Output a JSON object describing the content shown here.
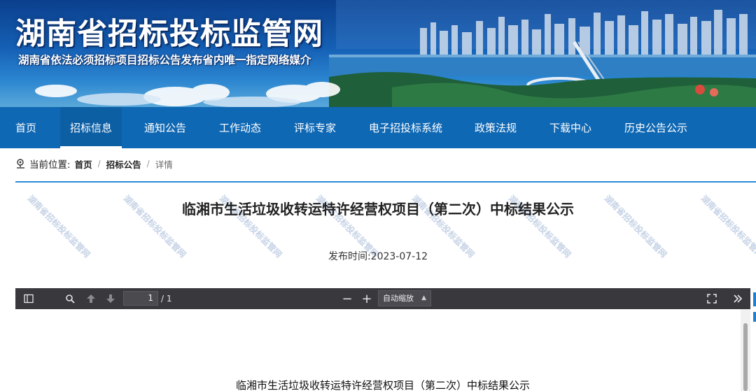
{
  "banner": {
    "title": "湖南省招标投标监管网",
    "subtitle": "湖南省依法必须招标项目招标公告发布省内唯一指定网络媒介"
  },
  "nav": {
    "items": [
      {
        "label": "首页"
      },
      {
        "label": "招标信息",
        "active": true
      },
      {
        "label": "通知公告"
      },
      {
        "label": "工作动态"
      },
      {
        "label": "评标专家"
      },
      {
        "label": "电子招投标系统"
      },
      {
        "label": "政策法规"
      },
      {
        "label": "下载中心"
      },
      {
        "label": "历史公告公示"
      }
    ]
  },
  "breadcrumb": {
    "prefix": "当前位置:",
    "items": [
      "首页",
      "招标公告",
      "详情"
    ],
    "separator": "/"
  },
  "article": {
    "title": "临湘市生活垃圾收转运特许经营权项目（第二次）中标结果公示",
    "publish_label": "发布时间:",
    "publish_date": "2023-07-12"
  },
  "watermark": {
    "text": "湖南省招标投标监管网"
  },
  "pdf_viewer": {
    "page_current": "1",
    "page_total": "/ 1",
    "zoom": "自动缩放",
    "zoom_out": "−",
    "zoom_in": "+",
    "document_title": "临湘市生活垃圾收转运特许经营权项目（第二次）中标结果公示"
  },
  "colors": {
    "nav_bg": "#0f68b4",
    "divider": "#2a8ad6",
    "toolbar_bg": "#38383d"
  }
}
